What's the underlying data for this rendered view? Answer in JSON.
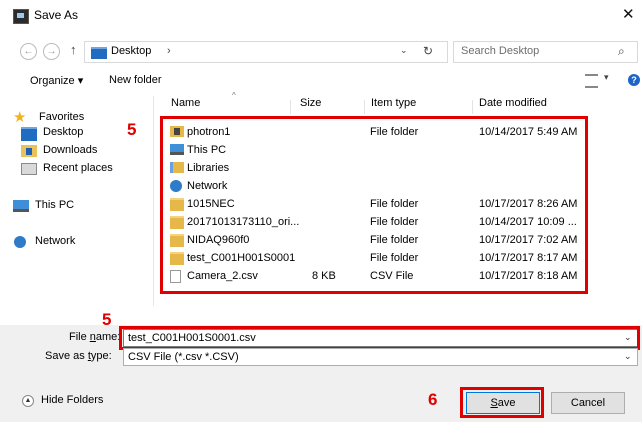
{
  "window": {
    "title": "Save As",
    "close_glyph": "✕"
  },
  "address": {
    "back": "←",
    "forward": "→",
    "up": "↑",
    "path": "Desktop",
    "chevron": "›",
    "dropdown": "⌄",
    "refresh": "↻"
  },
  "search": {
    "placeholder": "Search Desktop",
    "icon": "⌕"
  },
  "toolbar": {
    "organize": "Organize ▾",
    "new_folder": "New folder",
    "view_dd": "▾",
    "help": "?"
  },
  "sidebar": {
    "favorites": "Favorites",
    "items": [
      "Desktop",
      "Downloads",
      "Recent places"
    ],
    "this_pc": "This PC",
    "network": "Network"
  },
  "columns": {
    "name": "Name",
    "size": "Size",
    "type": "Item type",
    "date": "Date modified",
    "sort": "^"
  },
  "files": [
    {
      "name": "photron1",
      "size": "",
      "type": "File folder",
      "date": "10/14/2017 5:49 AM",
      "icon": "photron-folder-icon"
    },
    {
      "name": "This PC",
      "size": "",
      "type": "",
      "date": "",
      "icon": "pc-icon"
    },
    {
      "name": "Libraries",
      "size": "",
      "type": "",
      "date": "",
      "icon": "libraries-icon"
    },
    {
      "name": "Network",
      "size": "",
      "type": "",
      "date": "",
      "icon": "network-icon"
    },
    {
      "name": "1015NEC",
      "size": "",
      "type": "File folder",
      "date": "10/17/2017 8:26 AM",
      "icon": "folder-icon"
    },
    {
      "name": "20171013173110_ori...",
      "size": "",
      "type": "File folder",
      "date": "10/14/2017 10:09 ...",
      "icon": "folder-icon"
    },
    {
      "name": "NIDAQ960f0",
      "size": "",
      "type": "File folder",
      "date": "10/17/2017 7:02 AM",
      "icon": "folder-icon"
    },
    {
      "name": "test_C001H001S0001",
      "size": "",
      "type": "File folder",
      "date": "10/17/2017 8:17 AM",
      "icon": "folder-icon"
    },
    {
      "name": "Camera_2.csv",
      "size": "8 KB",
      "type": "CSV File",
      "date": "10/17/2017 8:18 AM",
      "icon": "csv-file-icon"
    }
  ],
  "filename": {
    "label_pre": "File ",
    "label_u": "n",
    "label_post": "ame:",
    "value": "test_C001H001S0001.csv",
    "dropdown": "⌄"
  },
  "filetype": {
    "label_pre": "Save as ",
    "label_u": "t",
    "label_post": "ype:",
    "value": "CSV File (*.csv *.CSV)",
    "dropdown": "⌄"
  },
  "hide_folders": {
    "label": "Hide Folders",
    "icon": "▲"
  },
  "buttons": {
    "save_u": "S",
    "save_rest": "ave",
    "cancel": "Cancel"
  },
  "annotations": {
    "marker_list": "5",
    "marker_filename": "5",
    "marker_save": "6"
  },
  "colors": {
    "highlight": "#e00000",
    "accent": "#0078d7"
  }
}
